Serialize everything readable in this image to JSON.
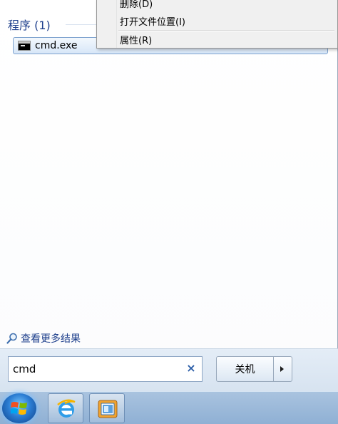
{
  "results": {
    "section_title": "程序 (1)",
    "items": [
      {
        "label": "cmd.exe",
        "icon": "cmd-icon"
      }
    ]
  },
  "see_more": {
    "label": "查看更多结果",
    "icon": "search-icon"
  },
  "search": {
    "value": "cmd",
    "clear_icon": "×"
  },
  "shutdown": {
    "label": "关机"
  },
  "context_menu": {
    "items": [
      {
        "label": "删除(D)"
      },
      {
        "label": "打开文件位置(I)"
      },
      {
        "label": "属性(R)"
      }
    ]
  },
  "taskbar": {
    "pinned": [
      {
        "name": "internet-explorer",
        "icon": "ie-icon"
      },
      {
        "name": "file-explorer",
        "icon": "explorer-icon"
      }
    ]
  },
  "colors": {
    "accent": "#1e3f8c",
    "selection": "#d7e6f8",
    "taskbar": "#a9c3df"
  }
}
